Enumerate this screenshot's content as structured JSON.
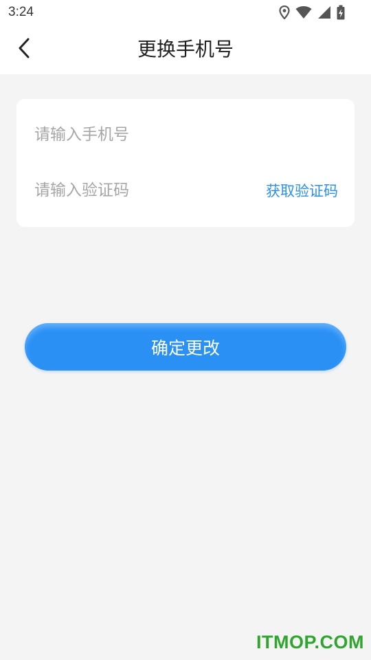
{
  "status_bar": {
    "time": "3:24",
    "icons": [
      "location-icon",
      "wifi-icon",
      "cellular-signal-icon",
      "battery-charging-icon"
    ]
  },
  "nav": {
    "title": "更换手机号",
    "back_icon": "chevron-left-icon"
  },
  "form": {
    "phone_placeholder": "请输入手机号",
    "phone_value": "",
    "code_placeholder": "请输入验证码",
    "code_value": "",
    "get_code_label": "获取验证码"
  },
  "confirm_button_label": "确定更改",
  "watermark": "ITMOP.COM",
  "colors": {
    "accent": "#2b90f4",
    "link": "#2a8ff0",
    "background": "#f4f4f4",
    "watermark": "#2fa52f"
  }
}
